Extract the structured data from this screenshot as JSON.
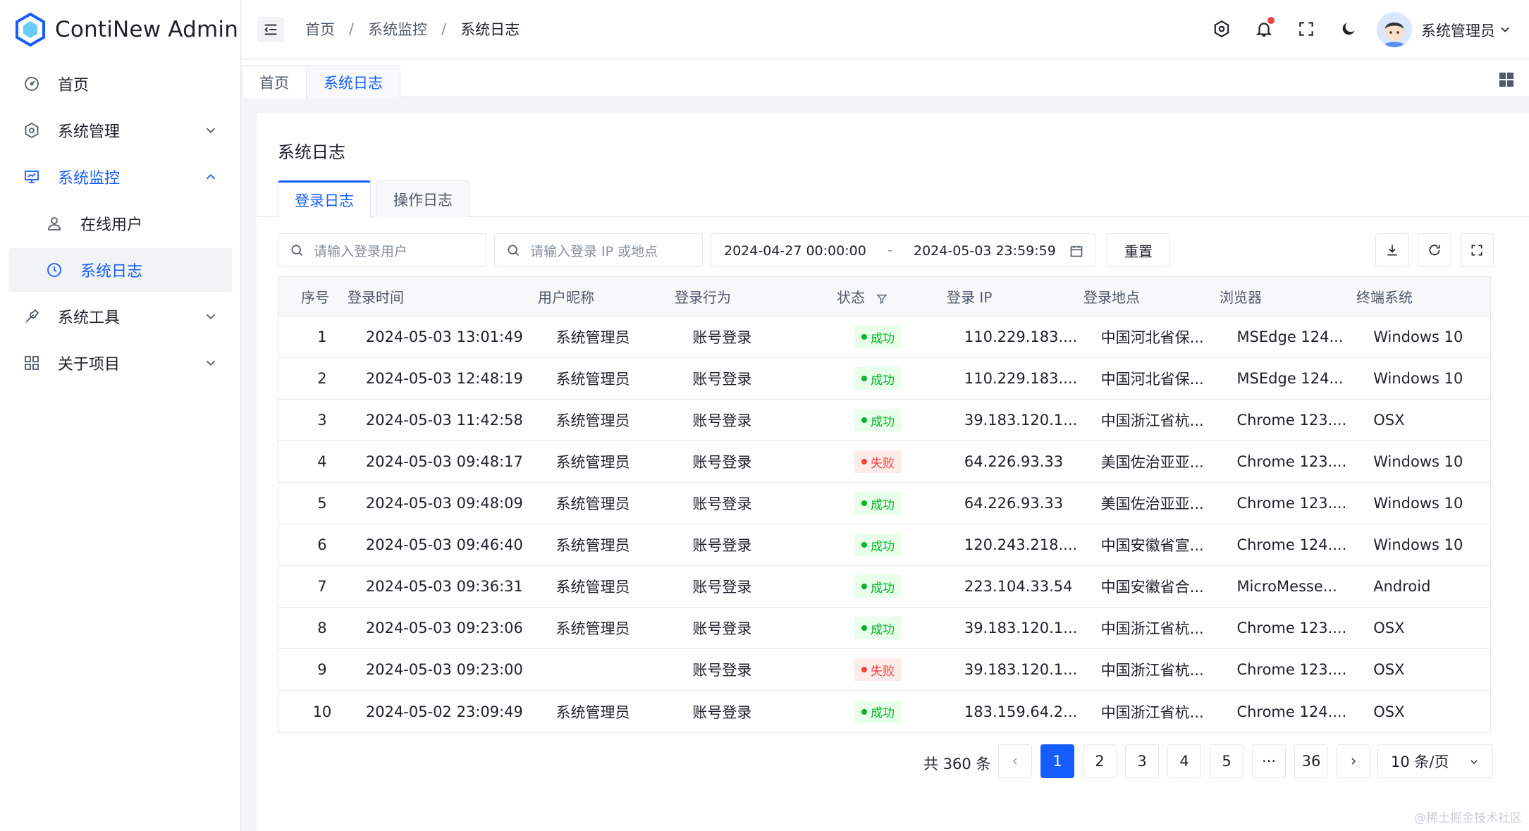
{
  "app": {
    "title": "ContiNew Admin",
    "accent": "#165dff"
  },
  "sidebar": {
    "items": [
      {
        "label": "首页",
        "icon": "dashboard-icon"
      },
      {
        "label": "系统管理",
        "icon": "gear-icon"
      },
      {
        "label": "系统监控",
        "icon": "monitor-icon"
      },
      {
        "label": "在线用户",
        "icon": "user-icon"
      },
      {
        "label": "系统日志",
        "icon": "clock-icon"
      },
      {
        "label": "系统工具",
        "icon": "wrench-icon"
      },
      {
        "label": "关于项目",
        "icon": "apps-icon"
      }
    ]
  },
  "header": {
    "breadcrumb": [
      "首页",
      "系统监控",
      "系统日志"
    ],
    "separator": "/",
    "user_name": "系统管理员"
  },
  "tabbar": {
    "tabs": [
      "首页",
      "系统日志"
    ]
  },
  "card": {
    "title": "系统日志",
    "tabs": [
      "登录日志",
      "操作日志"
    ],
    "search_user_placeholder": "请输入登录用户",
    "search_ip_placeholder": "请输入登录 IP 或地点",
    "date_start": "2024-04-27 00:00:00",
    "date_sep": "-",
    "date_end": "2024-05-03 23:59:59",
    "reset_label": "重置"
  },
  "table": {
    "headers": [
      "序号",
      "登录时间",
      "用户昵称",
      "登录行为",
      "状态",
      "登录 IP",
      "登录地点",
      "浏览器",
      "终端系统"
    ],
    "rows": [
      [
        "1",
        "2024-05-03 13:01:49",
        "系统管理员",
        "账号登录",
        "成功",
        "110.229.183....",
        "中国河北省保...",
        "MSEdge 124...",
        "Windows 10"
      ],
      [
        "2",
        "2024-05-03 12:48:19",
        "系统管理员",
        "账号登录",
        "成功",
        "110.229.183....",
        "中国河北省保...",
        "MSEdge 124...",
        "Windows 10"
      ],
      [
        "3",
        "2024-05-03 11:42:58",
        "系统管理员",
        "账号登录",
        "成功",
        "39.183.120.1...",
        "中国浙江省杭...",
        "Chrome 123....",
        "OSX"
      ],
      [
        "4",
        "2024-05-03 09:48:17",
        "系统管理员",
        "账号登录",
        "失败",
        "64.226.93.33",
        "美国佐治亚亚...",
        "Chrome 123....",
        "Windows 10"
      ],
      [
        "5",
        "2024-05-03 09:48:09",
        "系统管理员",
        "账号登录",
        "成功",
        "64.226.93.33",
        "美国佐治亚亚...",
        "Chrome 123....",
        "Windows 10"
      ],
      [
        "6",
        "2024-05-03 09:46:40",
        "系统管理员",
        "账号登录",
        "成功",
        "120.243.218....",
        "中国安徽省宣...",
        "Chrome 124....",
        "Windows 10"
      ],
      [
        "7",
        "2024-05-03 09:36:31",
        "系统管理员",
        "账号登录",
        "成功",
        "223.104.33.54",
        "中国安徽省合...",
        "MicroMesse...",
        "Android"
      ],
      [
        "8",
        "2024-05-03 09:23:06",
        "系统管理员",
        "账号登录",
        "成功",
        "39.183.120.1...",
        "中国浙江省杭...",
        "Chrome 123....",
        "OSX"
      ],
      [
        "9",
        "2024-05-03 09:23:00",
        "",
        "账号登录",
        "失败",
        "39.183.120.1...",
        "中国浙江省杭...",
        "Chrome 123....",
        "OSX"
      ],
      [
        "10",
        "2024-05-02 23:09:49",
        "系统管理员",
        "账号登录",
        "成功",
        "183.159.64.2...",
        "中国浙江省杭...",
        "Chrome 124....",
        "OSX"
      ]
    ]
  },
  "pagination": {
    "total_label": "共 360 条",
    "pages": [
      "1",
      "2",
      "3",
      "4",
      "5",
      "···",
      "36"
    ],
    "page_size": "10 条/页"
  },
  "watermark": "@稀土掘金技术社区"
}
